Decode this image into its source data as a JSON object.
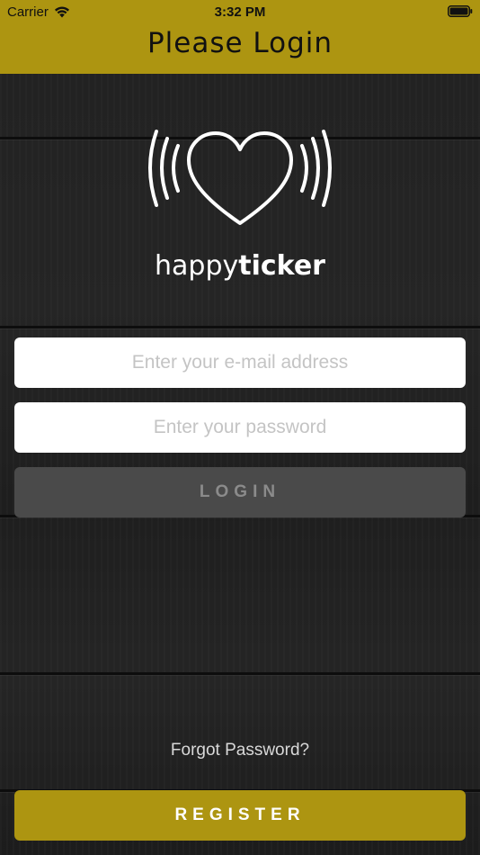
{
  "status_bar": {
    "carrier": "Carrier",
    "time": "3:32 PM"
  },
  "nav": {
    "title": "Please Login"
  },
  "brand": {
    "name_light": "happy",
    "name_bold": "ticker"
  },
  "form": {
    "email_placeholder": "Enter your e-mail address",
    "password_placeholder": "Enter your password",
    "login_label": "LOGIN",
    "forgot_label": "Forgot Password?",
    "register_label": "REGISTER"
  },
  "colors": {
    "accent": "#ad9511",
    "login_button": "#4a4a4a",
    "background": "#232323"
  },
  "icons": {
    "logo": "heart-with-signal-waves-icon",
    "wifi": "wifi-icon",
    "battery": "battery-icon"
  }
}
